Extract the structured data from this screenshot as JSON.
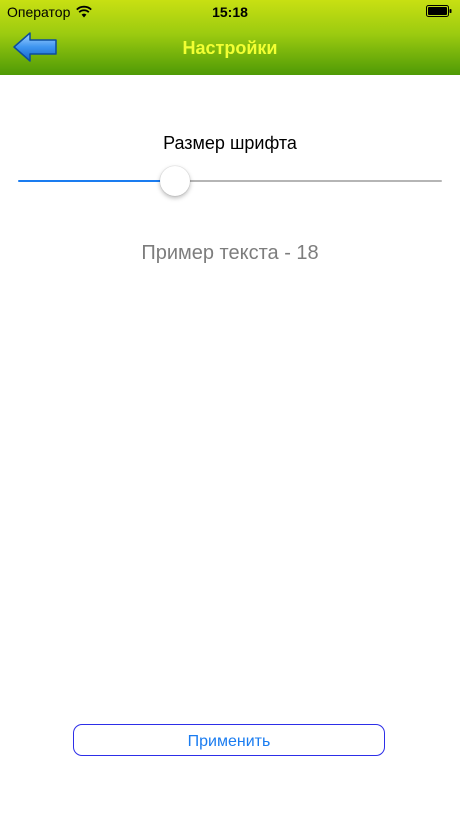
{
  "status_bar": {
    "carrier": "Оператор",
    "time": "15:18",
    "wifi_icon": "wifi-icon",
    "battery_icon": "battery-icon"
  },
  "nav_bar": {
    "title": "Настройки",
    "back_icon": "back-arrow-icon",
    "gradient_colors": [
      "#c8e012",
      "#9ccb10",
      "#4f9a06"
    ],
    "title_color": "#f2ff32"
  },
  "font_size_section": {
    "title": "Размер шрифта",
    "slider_fraction": 0.36,
    "slider_min_track_color": "#1a7cf0",
    "slider_max_track_color": "#b5b5b5"
  },
  "preview": {
    "text": "Пример текста - 18"
  },
  "apply_button": {
    "label": "Применить",
    "border_color": "#2d2ee8",
    "text_color": "#1a7cf0"
  }
}
